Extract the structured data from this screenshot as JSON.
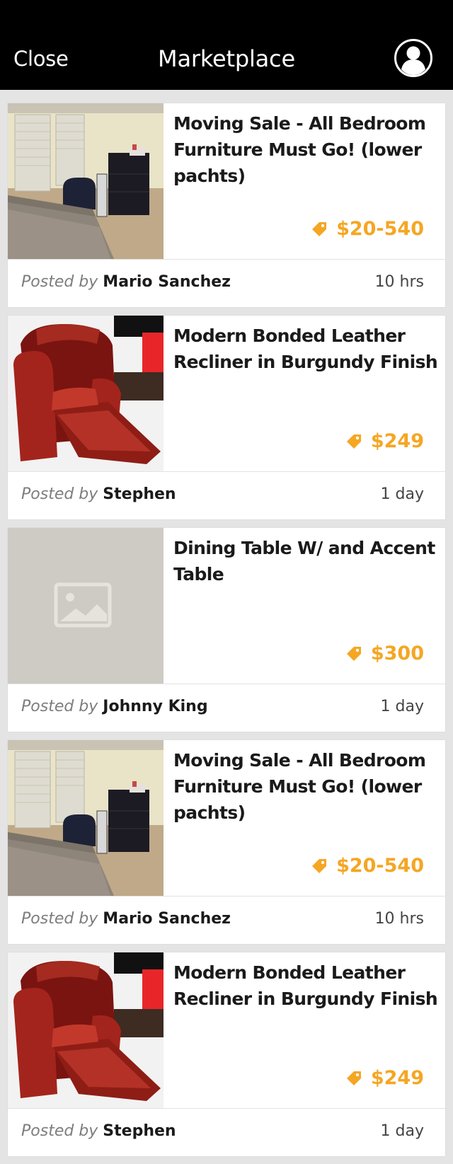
{
  "header": {
    "close_label": "Close",
    "title": "Marketplace",
    "profile_icon": "user-circle-icon"
  },
  "colors": {
    "topbar": "#000000",
    "background": "#e4e4e4",
    "price": "#F5A623",
    "title": "#1A1A1A",
    "posted_by": "#7D7D7D",
    "time": "#444444"
  },
  "listings": [
    {
      "title": "Moving Sale - All Bedroom Furniture Must Go! (lower pachts)",
      "price": "$20-540",
      "posted_by_label": "Posted by",
      "author": "Mario Sanchez",
      "time": "10 hrs",
      "image": "bedroom-photo"
    },
    {
      "title": "Modern Bonded Leather Recliner in Burgundy Finish",
      "price": "$249",
      "posted_by_label": "Posted by",
      "author": "Stephen",
      "time": "1 day",
      "image": "recliner-photo"
    },
    {
      "title": "Dining Table W/ and Accent Table",
      "price": "$300",
      "posted_by_label": "Posted by",
      "author": "Johnny King",
      "time": "1 day",
      "image": "image-placeholder"
    },
    {
      "title": "Moving Sale - All Bedroom Furniture Must Go! (lower pachts)",
      "price": "$20-540",
      "posted_by_label": "Posted by",
      "author": "Mario Sanchez",
      "time": "10 hrs",
      "image": "bedroom-photo"
    },
    {
      "title": "Modern Bonded Leather Recliner in Burgundy Finish",
      "price": "$249",
      "posted_by_label": "Posted by",
      "author": "Stephen",
      "time": "1 day",
      "image": "recliner-photo"
    }
  ]
}
